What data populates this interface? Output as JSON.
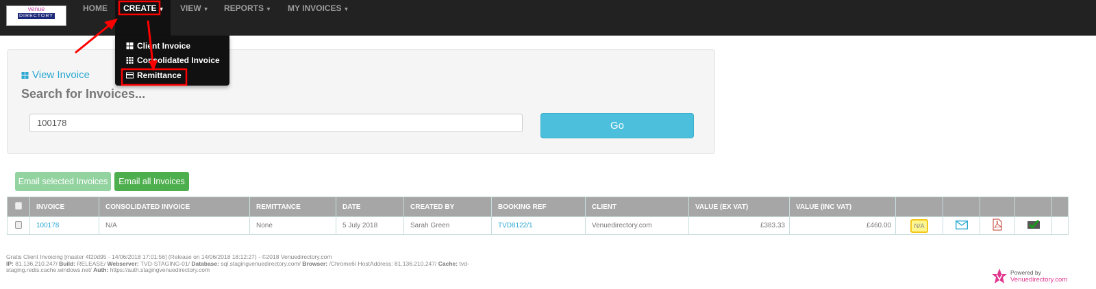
{
  "nav": {
    "logo_text": "venue directory",
    "items": [
      {
        "label": "HOME"
      },
      {
        "label": "CREATE"
      },
      {
        "label": "VIEW"
      },
      {
        "label": "REPORTS"
      },
      {
        "label": "MY INVOICES"
      }
    ]
  },
  "dropdown": {
    "items": [
      {
        "label": "Client Invoice",
        "icon": "th-large-icon"
      },
      {
        "label": "Consolidated Invoice",
        "icon": "th-icon"
      },
      {
        "label": "Remittance",
        "icon": "credit-card-icon"
      }
    ]
  },
  "search_panel": {
    "link": "View Invoice",
    "heading": "Search for Invoices...",
    "input_value": "100178",
    "go_label": "Go"
  },
  "actions": {
    "email_selected": "Email selected Invoices",
    "email_all": "Email all Invoices"
  },
  "table": {
    "headers": [
      "INVOICE",
      "CONSOLIDATED INVOICE",
      "REMITTANCE",
      "DATE",
      "CREATED BY",
      "BOOKING REF",
      "CLIENT",
      "VALUE (EX VAT)",
      "VALUE (INC VAT)"
    ],
    "rows": [
      {
        "invoice": "100178",
        "consolidated": "N/A",
        "remittance": "None",
        "date": "5 July 2018",
        "created_by": "Sarah Green",
        "booking_ref": "TVD8122/1",
        "client": "Venuedirectory.com",
        "value_ex": "£383.33",
        "value_inc": "£460.00",
        "status": "N/A"
      }
    ]
  },
  "footer": {
    "line1": "Gratis Client Invoicing [master 4f20d95 - 14/06/2018 17:01:56] (Release on 14/06/2018 18:12:27) - ©2018 Venuedirectory.com",
    "ip_label": "IP:",
    "ip": "81.136.210.247/",
    "build_label": "Build:",
    "build": "RELEASE/",
    "webserver_label": "Webserver:",
    "webserver": "TVD-STAGING-01/",
    "database_label": "Database:",
    "database": "sql.stagingvenuedirectory.com/",
    "browser_label": "Browser:",
    "browser": "/Chrome6/ HostAddress: 81.136.210.247/",
    "cache_label": "Cache:",
    "cache": "tvd-staging.redis.cache.windows.net/",
    "auth_label": "Auth:",
    "auth": "https://auth.stagingvenuedirectory.com",
    "powered_by": "Powered by",
    "powered_brand": "Venuedirectory.com"
  },
  "colors": {
    "accent": "#2aa8d2",
    "go": "#4bbfdc",
    "success": "#4cae4c",
    "annotation": "#ff0000"
  }
}
